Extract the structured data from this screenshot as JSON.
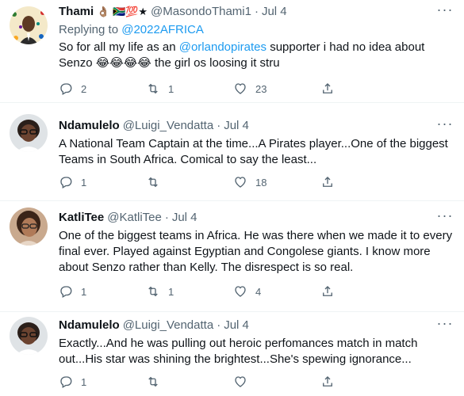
{
  "tweets": [
    {
      "name": "Thami",
      "emojis": "👌🏽 🇿🇦💯★",
      "handle": "@MasondoThami1",
      "date": "Jul 4",
      "reply_prefix": "Replying to ",
      "reply_to": "@2022AFRICA",
      "body_parts": [
        "So for all my life as an ",
        "@orlandopirates",
        " supporter i had no idea about Senzo ",
        "😂😂😂😂",
        " the girl os loosing it stru"
      ],
      "replies": "2",
      "retweets": "1",
      "likes": "23"
    },
    {
      "name": "Ndamulelo",
      "handle": "@Luigi_Vendatta",
      "date": "Jul 4",
      "body": "A National Team Captain at the time...A Pirates player...One of the biggest Teams in South Africa. Comical to say the least...",
      "replies": "1",
      "retweets": "",
      "likes": "18"
    },
    {
      "name": "KatliTee",
      "handle": "@KatliTee",
      "date": "Jul 4",
      "body": "One of the biggest teams in Africa. He was there when we made it to every final ever. Played against Egyptian and Congolese giants. I know more about Senzo rather than Kelly. The disrespect is so real.",
      "replies": "1",
      "retweets": "1",
      "likes": "4"
    },
    {
      "name": "Ndamulelo",
      "handle": "@Luigi_Vendatta",
      "date": "Jul 4",
      "body": "Exactly...And he was pulling out heroic perfomances match in match out...His star was shining the brightest...She's spewing ignorance...",
      "replies": "1",
      "retweets": "",
      "likes": ""
    }
  ],
  "separator": "·",
  "more_label": "···",
  "colors": {
    "link": "#1d9bf0",
    "secondary": "#536471",
    "text": "#0f1419"
  },
  "icons": [
    "reply-icon",
    "retweet-icon",
    "like-icon",
    "share-icon",
    "more-icon"
  ]
}
